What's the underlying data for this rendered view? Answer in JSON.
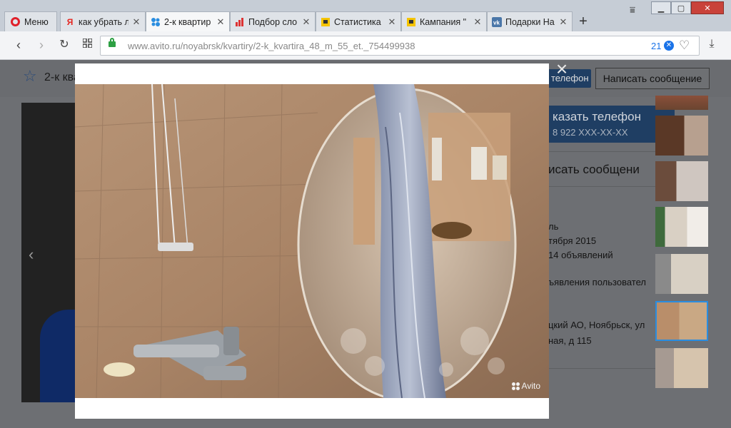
{
  "browser": {
    "menu_label": "Меню",
    "tabs": [
      {
        "label": "как убрать л",
        "icon": "yandex-icon"
      },
      {
        "label": "2-к квартир",
        "icon": "avito-icon"
      },
      {
        "label": "Подбор сло",
        "icon": "bar-chart-icon"
      },
      {
        "label": "Статистика",
        "icon": "yandex-direct-icon"
      },
      {
        "label": "Кампания \"",
        "icon": "yandex-direct-icon"
      },
      {
        "label": "Подарки На",
        "icon": "vk-icon"
      }
    ],
    "new_tab_label": "+",
    "url": "www.avito.ru/noyabrsk/kvartiry/2-k_kvartira_48_m_55_et._754499938",
    "adblock_count": "21"
  },
  "page": {
    "ad_title": "2-к ква",
    "phone_button_small": "телефон",
    "message_button": "Написать сообщение",
    "phone_block_title": "казать телефон",
    "phone_block_number": "8 922 XXX-XX-XX",
    "write_message": "исать сообщени",
    "seller_type": "ль",
    "seller_since": "тября 2015",
    "seller_ads_count": "14 объявлений",
    "seller_ads_link": "ъявления пользовател",
    "address_line1": "цкий АО, Ноябрьск, ул",
    "address_line2": "ная, д 115"
  },
  "modal": {
    "close_label": "×",
    "watermark": "Avito"
  },
  "colors": {
    "accent_blue": "#1f3e63",
    "selected_thumb": "#2a8de0",
    "lock_green": "#2ea044",
    "opera_red": "#e0202a"
  }
}
